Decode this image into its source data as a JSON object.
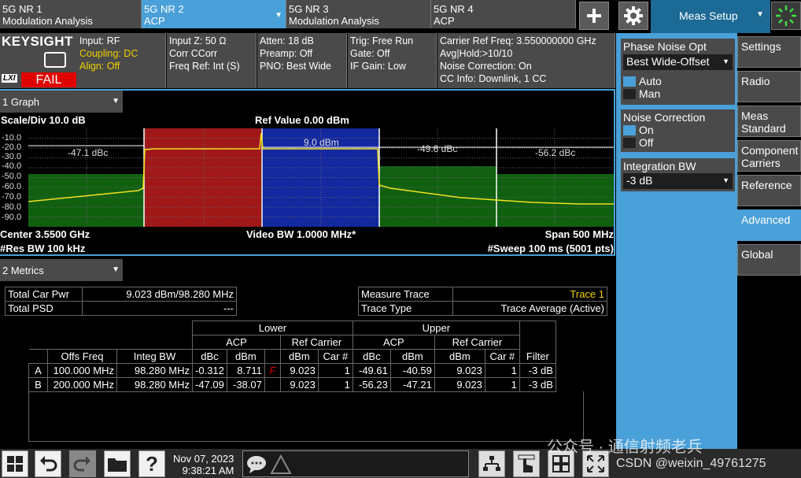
{
  "tabs": [
    {
      "line1": "5G NR 1",
      "line2": "Modulation Analysis"
    },
    {
      "line1": "5G NR 2",
      "line2": "ACP"
    },
    {
      "line1": "5G NR 3",
      "line2": "Modulation Analysis"
    },
    {
      "line1": "5G NR 4",
      "line2": "ACP"
    }
  ],
  "top_buttons": {
    "add_icon": "plus-icon",
    "settings_icon": "gear-icon",
    "meas_setup": "Meas Setup",
    "status_icon": "sun-icon"
  },
  "brand": {
    "name": "KEYSIGHT",
    "lxi": "LXI",
    "fail": "FAIL"
  },
  "info": {
    "col1": [
      "Input: RF",
      "Coupling: DC",
      "Align: Off"
    ],
    "col2": [
      "Input Z: 50 Ω",
      "Corr CCorr",
      "Freq Ref: Int (S)"
    ],
    "col3": [
      "Atten: 18 dB",
      "Preamp: Off",
      "PNO: Best Wide"
    ],
    "col4": [
      "Trig: Free Run",
      "Gate: Off",
      "IF Gain: Low"
    ],
    "col5": [
      "Carrier Ref Freq: 3.550000000 GHz",
      "Avg|Hold:>10/10",
      "Noise Correction: On",
      "CC Info: Downlink, 1 CC"
    ]
  },
  "graph": {
    "selector": "1 Graph",
    "scale": "Scale/Div 10.0 dB",
    "ref_value": "Ref Value 0.00 dBm",
    "yticks": [
      "-10.0",
      "-20.0",
      "-30.0",
      "-40.0",
      "-50.0",
      "-60.0",
      "-70.0",
      "-80.0",
      "-90.0"
    ],
    "annotations": {
      "lower2": "-47.1 dBc",
      "carrier": "9.0 dBm",
      "upper1": "-49.6 dBc",
      "upper2": "-56.2 dBc"
    },
    "center": "Center 3.5500 GHz",
    "res_bw": "#Res BW 100 kHz",
    "video_bw": "Video BW 1.0000 MHz*",
    "span": "Span 500 MHz",
    "sweep": "#Sweep 100 ms  (5001 pts)"
  },
  "metrics": {
    "selector": "2 Metrics",
    "total_car_pwr_label": "Total Car Pwr",
    "total_car_pwr_value": "9.023 dBm/98.280 MHz",
    "total_psd_label": "Total PSD",
    "total_psd_value": "---",
    "measure_trace_label": "Measure Trace",
    "measure_trace_value": "Trace 1",
    "trace_type_label": "Trace Type",
    "trace_type_value": "Trace Average (Active)",
    "headers": {
      "lower": "Lower",
      "upper": "Upper",
      "acp": "ACP",
      "ref_carrier": "Ref Carrier",
      "offs_freq": "Offs Freq",
      "integ_bw": "Integ BW",
      "dbc": "dBc",
      "dbm": "dBm",
      "car_num": "Car #",
      "filter": "Filter"
    },
    "rows": [
      {
        "id": "A",
        "offs": "100.000 MHz",
        "integ": "98.280 MHz",
        "l_dbc": "-0.312",
        "l_dbm": "8.711",
        "flag": "F",
        "l_ref": "9.023",
        "l_car": "1",
        "u_dbc": "-49.61",
        "u_dbm": "-40.59",
        "u_ref": "9.023",
        "u_car": "1",
        "filter": "-3 dB"
      },
      {
        "id": "B",
        "offs": "200.000 MHz",
        "integ": "98.280 MHz",
        "l_dbc": "-47.09",
        "l_dbm": "-38.07",
        "flag": "",
        "l_ref": "9.023",
        "l_car": "1",
        "u_dbc": "-56.23",
        "u_dbm": "-47.21",
        "u_ref": "9.023",
        "u_car": "1",
        "filter": "-3 dB"
      }
    ]
  },
  "right_panel": {
    "phase_noise_title": "Phase Noise Opt",
    "phase_noise_value": "Best Wide-Offset",
    "auto": "Auto",
    "man": "Man",
    "noise_corr_title": "Noise Correction",
    "on": "On",
    "off": "Off",
    "int_bw_title": "Integration BW",
    "int_bw_value": "-3 dB",
    "menu": [
      "Settings",
      "Radio",
      "Meas Standard",
      "Component Carriers",
      "Reference",
      "Advanced",
      "Global"
    ]
  },
  "taskbar": {
    "date": "Nov 07, 2023",
    "time": "9:38:21 AM",
    "icons": [
      "windows-icon",
      "undo-icon",
      "redo-icon",
      "folder-icon",
      "help-icon",
      "chat-icon",
      "warning-icon",
      "network-icon",
      "touch-icon",
      "grid-icon",
      "expand-icon"
    ]
  },
  "watermark": {
    "wechat": "公众号 · 通信射频老兵",
    "csdn": "CSDN @weixin_49761275"
  },
  "colors": {
    "accent": "#4aa0d8",
    "fail": "#e00000",
    "trace": "#f0e020",
    "carrier_band": "#1428a0",
    "adjacent_band": "#a01818",
    "outer_band": "#106010"
  }
}
